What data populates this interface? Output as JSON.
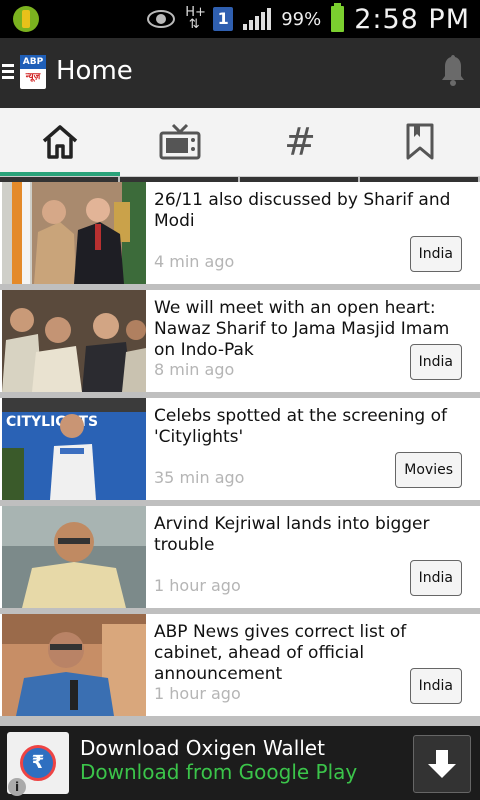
{
  "status_bar": {
    "network_label": "H+",
    "sim_label": "1",
    "battery_percent": "99%",
    "time": "2:58 PM"
  },
  "action_bar": {
    "title": "Home",
    "logo_top": "ABP",
    "logo_bottom": "न्यूज़",
    "icons": [
      "menu-icon",
      "app-logo",
      "notification-bell-icon"
    ]
  },
  "tabs": [
    {
      "icon": "home-icon",
      "active": true
    },
    {
      "icon": "tv-icon",
      "active": false
    },
    {
      "icon": "hashtag-icon",
      "glyph": "#",
      "active": false
    },
    {
      "icon": "bookmark-icon",
      "active": false
    }
  ],
  "articles": [
    {
      "headline": "26/11 also discussed by Sharif and Modi",
      "time": "4 min ago",
      "tag": "India"
    },
    {
      "headline": "We will meet with an open heart: Nawaz Sharif to Jama Masjid Imam on Indo-Pak",
      "time": "8 min ago",
      "tag": "India"
    },
    {
      "headline": "Celebs spotted at the screening of 'Citylights'",
      "time": "35 min ago",
      "tag": "Movies",
      "thumb_text": "CITYLIGHTS"
    },
    {
      "headline": "Arvind Kejriwal lands into bigger trouble",
      "time": "1 hour ago",
      "tag": "India"
    },
    {
      "headline": "ABP News gives correct list of cabinet, ahead of official announcement",
      "time": "1 hour ago",
      "tag": "India"
    }
  ],
  "ad": {
    "title": "Download Oxigen Wallet",
    "subtitle": "Download from Google Play",
    "icon_symbol": "₹",
    "info": "i"
  }
}
